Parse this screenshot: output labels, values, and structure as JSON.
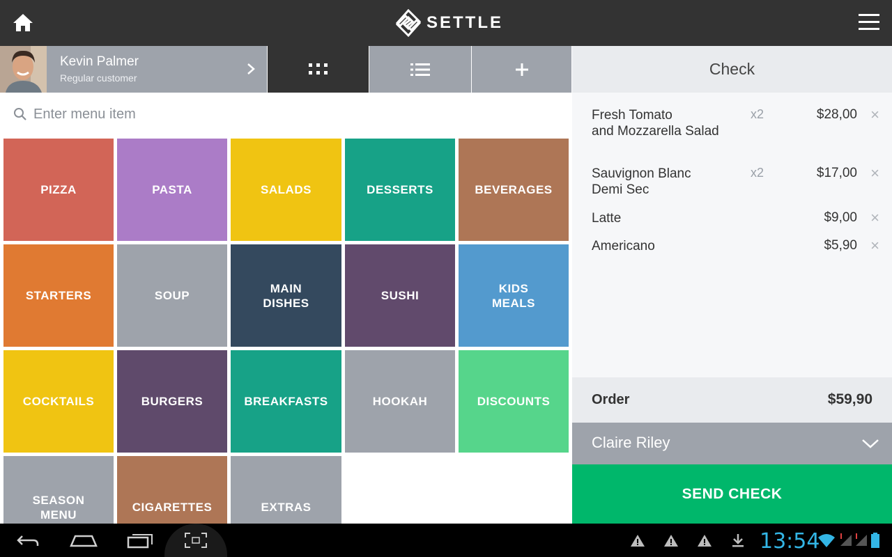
{
  "app": {
    "brand": "SETTLE"
  },
  "customer": {
    "name": "Kevin Palmer",
    "type": "Regular customer"
  },
  "search": {
    "placeholder": "Enter menu item"
  },
  "categories": [
    {
      "label": "PIZZA",
      "color": "#d26557"
    },
    {
      "label": "PASTA",
      "color": "#ab7cc7"
    },
    {
      "label": "SALADS",
      "color": "#f0c412"
    },
    {
      "label": "DESSERTS",
      "color": "#17a287"
    },
    {
      "label": "BEVERAGES",
      "color": "#ae7656"
    },
    {
      "label": "STARTERS",
      "color": "#e07a32"
    },
    {
      "label": "SOUP",
      "color": "#9ea3ab"
    },
    {
      "label": "MAIN\nDISHES",
      "color": "#34495e"
    },
    {
      "label": "SUSHI",
      "color": "#614a6c"
    },
    {
      "label": "KIDS\nMEALS",
      "color": "#539ace"
    },
    {
      "label": "COCKTAILS",
      "color": "#f0c412"
    },
    {
      "label": "BURGERS",
      "color": "#5f4a6b"
    },
    {
      "label": "BREAKFASTS",
      "color": "#17a287"
    },
    {
      "label": "HOOKAH",
      "color": "#9ea3ab"
    },
    {
      "label": "DISCOUNTS",
      "color": "#56d58b"
    },
    {
      "label": "SEASON\nMENU",
      "color": "#9ea3ab"
    },
    {
      "label": "CIGARETTES",
      "color": "#ae7656"
    },
    {
      "label": "EXTRAS",
      "color": "#9ea3ab"
    }
  ],
  "check": {
    "title": "Check",
    "items": [
      {
        "name": "Fresh Tomato\nand Mozzarella Salad",
        "qty": "x2",
        "price": "$28,00",
        "remove": "×"
      },
      {
        "name": "Sauvignon Blanc\nDemi Sec",
        "qty": "x2",
        "price": "$17,00",
        "remove": "×"
      },
      {
        "name": "Latte",
        "qty": "",
        "price": "$9,00",
        "remove": "×"
      },
      {
        "name": "Americano",
        "qty": "",
        "price": "$5,90",
        "remove": "×"
      }
    ],
    "order_label": "Order",
    "order_total": "$59,90",
    "waiter": "Claire Riley",
    "send_label": "SEND CHECK"
  },
  "system": {
    "clock": "13:54"
  }
}
